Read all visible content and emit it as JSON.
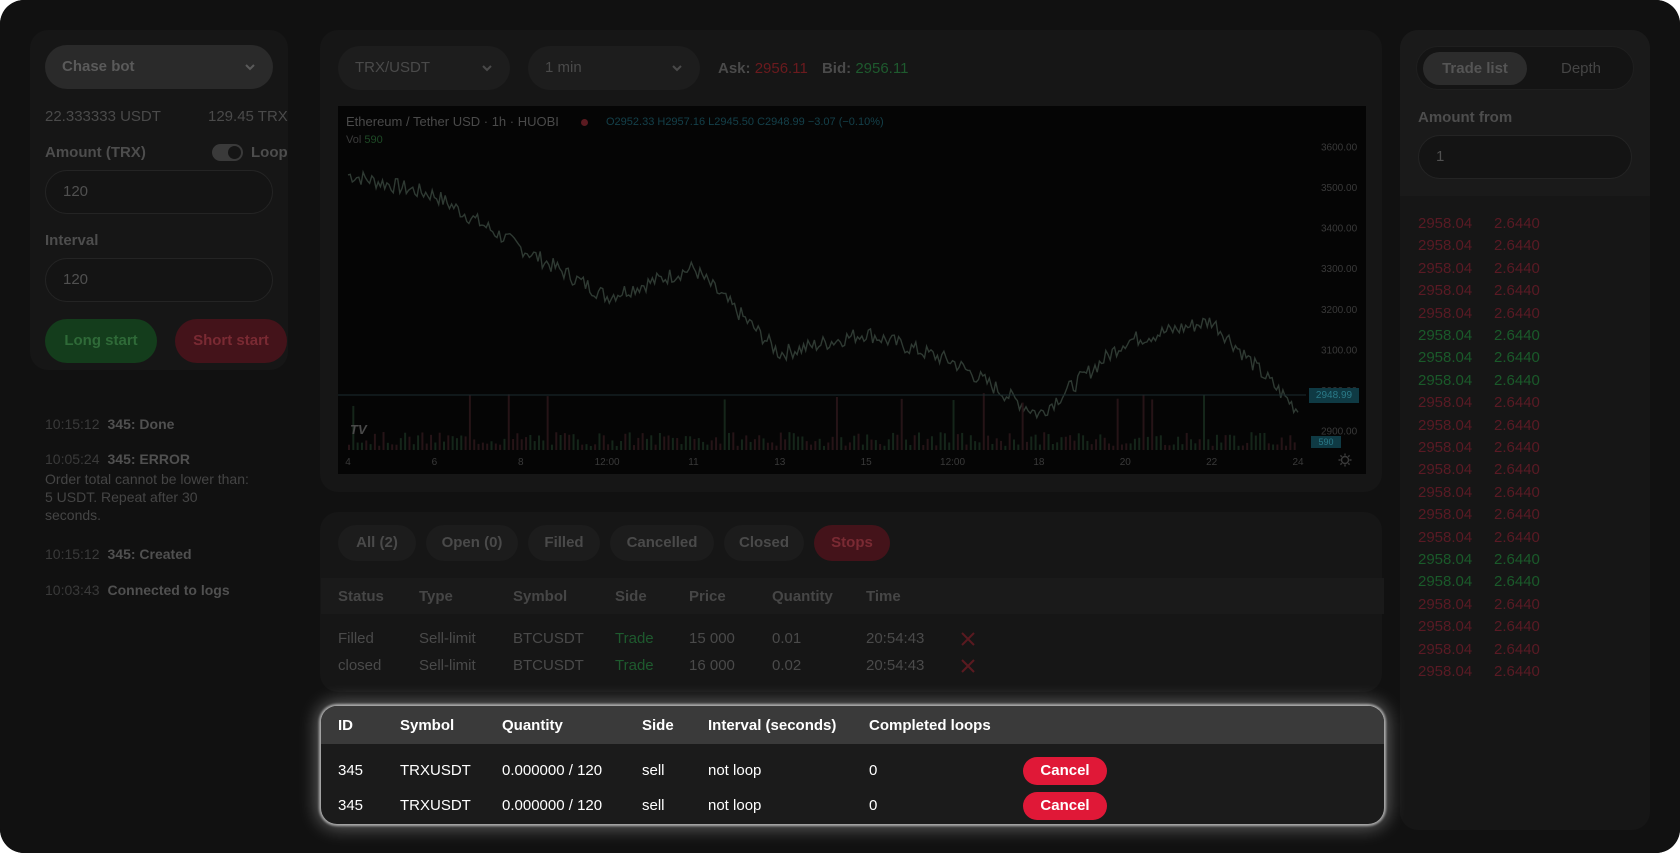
{
  "bot": {
    "selector": "Chase bot",
    "usdt_balance": "22.333333 USDT",
    "trx_balance": "129.45 TRX",
    "amount_label": "Amount (TRX)",
    "loop_label": "Loop",
    "amount_value": "120",
    "interval_label": "Interval",
    "interval_value": "120",
    "long_start": "Long start",
    "short_start": "Short start"
  },
  "logs": [
    {
      "time": "10:15:12",
      "message": "345: Done",
      "detail": ""
    },
    {
      "time": "10:05:24",
      "message": "345: ERROR",
      "detail": "Order total cannot be lower than: 5 USDT. Repeat after 30 seconds."
    },
    {
      "time": "10:15:12",
      "message": "345: Created",
      "detail": ""
    },
    {
      "time": "10:03:43",
      "message": "Connected to logs",
      "detail": ""
    }
  ],
  "market": {
    "pair": "TRX/USDT",
    "timeframe": "1 min",
    "ask_label": "Ask:",
    "ask_value": "2956.11",
    "bid_label": "Bid:",
    "bid_value": "2956.11"
  },
  "chart": {
    "title": "Ethereum / Tether USD · 1h · HUOBI",
    "ohlc": "O2952.33 H2957.16 L2945.50 C2948.99 −3.07 (−0.10%)",
    "vol_label": "Vol",
    "vol_value": "590",
    "y_ticks": [
      "3600.00",
      "3500.00",
      "3400.00",
      "3300.00",
      "3200.00",
      "3100.00",
      "3000.00",
      "2900.00"
    ],
    "x_ticks": [
      "4",
      "6",
      "8",
      "12:00",
      "11",
      "13",
      "15",
      "12:00",
      "18",
      "20",
      "22",
      "24"
    ],
    "price_tag": "2948.99",
    "vol_tag": "590",
    "logo": "TV"
  },
  "chart_data": {
    "type": "line",
    "title": "Ethereum / Tether USD · 1h · HUOBI",
    "xlabel": "",
    "ylabel": "",
    "x": [
      "4",
      "6",
      "8",
      "12:00",
      "11",
      "13",
      "15",
      "12:00",
      "18",
      "20",
      "22",
      "24"
    ],
    "series": [
      {
        "values": [
          3530,
          3480,
          3350,
          3230,
          3300,
          3090,
          3140,
          3070,
          2940,
          3120,
          3170,
          2950
        ]
      }
    ],
    "ylim": [
      2850,
      3650
    ],
    "grid": false
  },
  "orders": {
    "tabs": [
      "All (2)",
      "Open (0)",
      "Filled",
      "Cancelled",
      "Closed",
      "Stops"
    ],
    "headers": [
      "Status",
      "Type",
      "Symbol",
      "Side",
      "Price",
      "Quantity",
      "Time"
    ],
    "rows": [
      {
        "status": "Filled",
        "type": "Sell-limit",
        "symbol": "BTCUSDT",
        "side": "Trade",
        "price": "15 000",
        "quantity": "0.01",
        "time": "20:54:43"
      },
      {
        "status": "closed",
        "type": "Sell-limit",
        "symbol": "BTCUSDT",
        "side": "Trade",
        "price": "16 000",
        "quantity": "0.02",
        "time": "20:54:43"
      }
    ]
  },
  "right": {
    "tab_trade_list": "Trade list",
    "tab_depth": "Depth",
    "amount_from_label": "Amount from",
    "amount_from_value": "1",
    "book": [
      {
        "price": "2958.04",
        "amount": "2.6440",
        "side": "sell"
      },
      {
        "price": "2958.04",
        "amount": "2.6440",
        "side": "sell"
      },
      {
        "price": "2958.04",
        "amount": "2.6440",
        "side": "sell"
      },
      {
        "price": "2958.04",
        "amount": "2.6440",
        "side": "sell"
      },
      {
        "price": "2958.04",
        "amount": "2.6440",
        "side": "sell"
      },
      {
        "price": "2958.04",
        "amount": "2.6440",
        "side": "buy"
      },
      {
        "price": "2958.04",
        "amount": "2.6440",
        "side": "buy"
      },
      {
        "price": "2958.04",
        "amount": "2.6440",
        "side": "buy"
      },
      {
        "price": "2958.04",
        "amount": "2.6440",
        "side": "sell"
      },
      {
        "price": "2958.04",
        "amount": "2.6440",
        "side": "sell"
      },
      {
        "price": "2958.04",
        "amount": "2.6440",
        "side": "sell"
      },
      {
        "price": "2958.04",
        "amount": "2.6440",
        "side": "sell"
      },
      {
        "price": "2958.04",
        "amount": "2.6440",
        "side": "sell"
      },
      {
        "price": "2958.04",
        "amount": "2.6440",
        "side": "sell"
      },
      {
        "price": "2958.04",
        "amount": "2.6440",
        "side": "sell"
      },
      {
        "price": "2958.04",
        "amount": "2.6440",
        "side": "buy"
      },
      {
        "price": "2958.04",
        "amount": "2.6440",
        "side": "buy"
      },
      {
        "price": "2958.04",
        "amount": "2.6440",
        "side": "sell"
      },
      {
        "price": "2958.04",
        "amount": "2.6440",
        "side": "sell"
      },
      {
        "price": "2958.04",
        "amount": "2.6440",
        "side": "sell"
      },
      {
        "price": "2958.04",
        "amount": "2.6440",
        "side": "sell"
      }
    ]
  },
  "bots_table": {
    "headers": [
      "ID",
      "Symbol",
      "Quantity",
      "Side",
      "Interval (seconds)",
      "Completed loops"
    ],
    "rows": [
      {
        "id": "345",
        "symbol": "TRXUSDT",
        "quantity": "0.000000 / 120",
        "side": "sell",
        "interval": "not loop",
        "loops": "0",
        "action": "Cancel"
      },
      {
        "id": "345",
        "symbol": "TRXUSDT",
        "quantity": "0.000000 / 120",
        "side": "sell",
        "interval": "not loop",
        "loops": "0",
        "action": "Cancel"
      }
    ]
  },
  "colors": {
    "green": "#1a5a2a",
    "red": "#5a1a24",
    "accent_red": "#e01837",
    "ask_red": "#6b1a1e",
    "bid_green": "#1e5a2e"
  }
}
